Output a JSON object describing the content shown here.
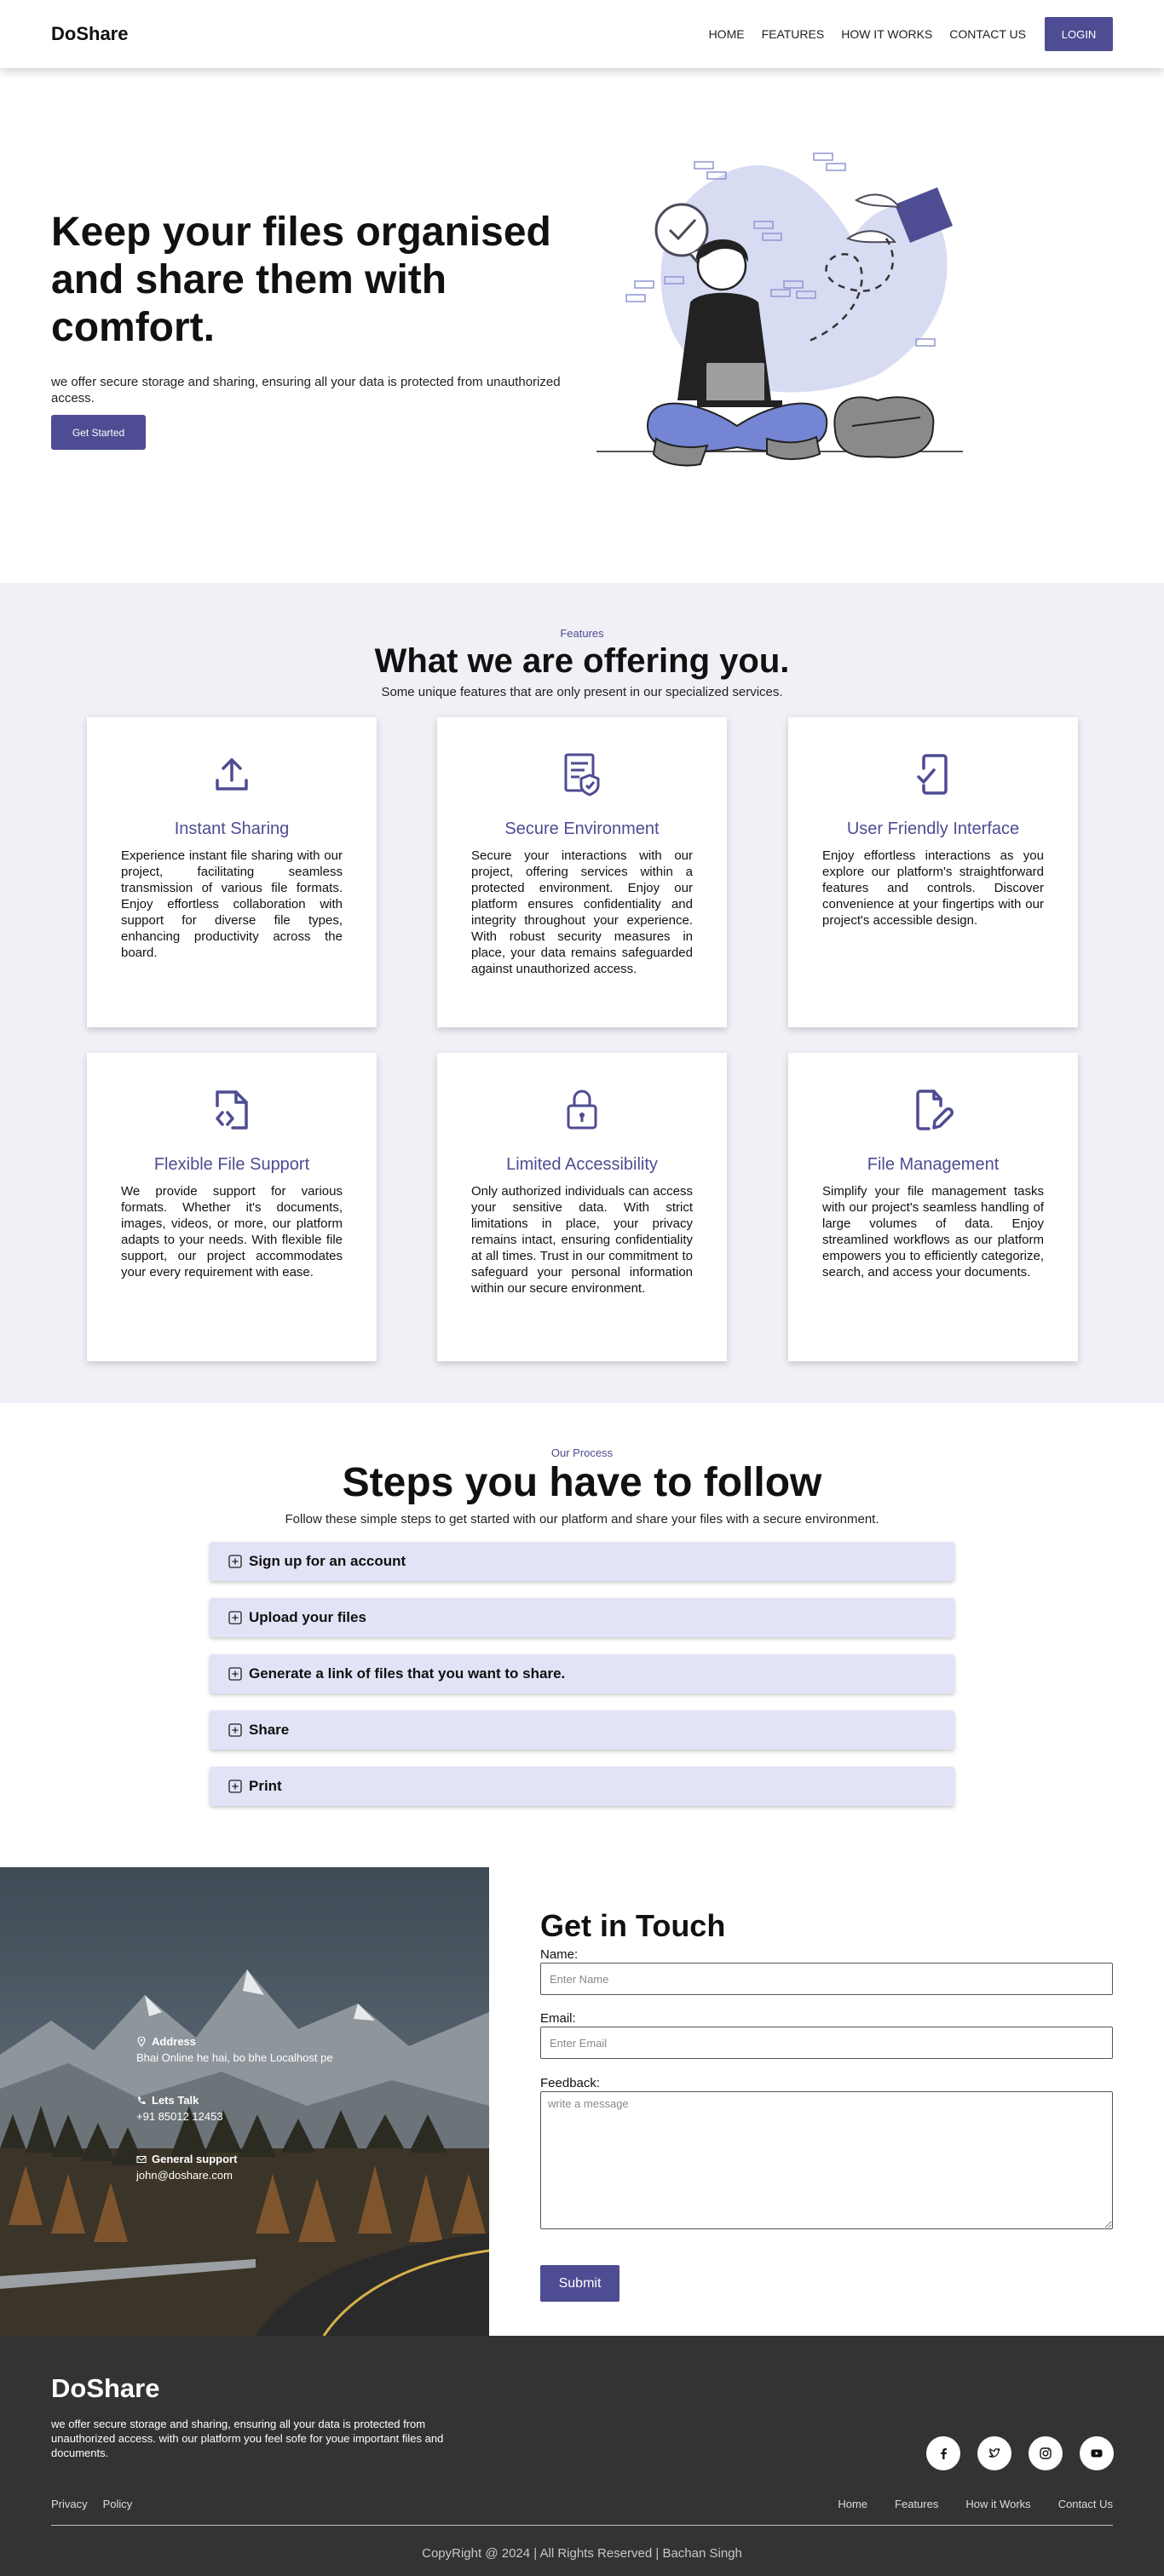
{
  "nav": {
    "brand": "DoShare",
    "links": [
      "HOME",
      "FEATURES",
      "HOW IT WORKS",
      "CONTACT US"
    ],
    "login": "LOGIN"
  },
  "hero": {
    "title": "Keep your files organised and share them with comfort.",
    "subtitle": "we offer secure storage and sharing, ensuring all your data is protected from unauthorized access.",
    "cta": "Get Started"
  },
  "features": {
    "eyebrow": "Features",
    "title": "What we are offering you.",
    "subtitle": "Some unique features that are only present in our specialized services.",
    "cards": [
      {
        "icon": "upload-icon",
        "title": "Instant Sharing",
        "text": "Experience instant file sharing with our project, facilitating seamless transmission of various file formats. Enjoy effortless collaboration with support for diverse file types, enhancing productivity across the board."
      },
      {
        "icon": "shield-document-icon",
        "title": "Secure Environment",
        "text": "Secure your interactions with our project, offering services within a protected environment. Enjoy our platform ensures confidentiality and integrity throughout your experience. With robust security measures in place, your data remains safeguarded against unauthorized access."
      },
      {
        "icon": "mobile-check-icon",
        "title": "User Friendly Interface",
        "text": "Enjoy effortless interactions as you explore our platform's straightforward features and controls. Discover convenience at your fingertips with our project's accessible design."
      },
      {
        "icon": "file-code-icon",
        "title": "Flexible File Support",
        "text": "We provide support for various formats. Whether it's documents, images, videos, or more, our platform adapts to your needs. With flexible file support, our project accommodates your every requirement with ease."
      },
      {
        "icon": "lock-icon",
        "title": "Limited Accessibility",
        "text": "Only authorized individuals can access your sensitive data. With strict limitations in place, your privacy remains intact, ensuring confidentiality at all times. Trust in our commitment to safeguard your personal information within our secure environment."
      },
      {
        "icon": "file-edit-icon",
        "title": "File Management",
        "text": "Simplify your file management tasks with our project's seamless handling of large volumes of data. Enjoy streamlined workflows as our platform empowers you to efficiently categorize, search, and access your documents."
      }
    ]
  },
  "steps": {
    "eyebrow": "Our Process",
    "title": "Steps you have to follow",
    "subtitle": "Follow these simple steps to get started with our platform and share your files with a secure environment.",
    "items": [
      "Sign up for an account",
      "Upload your files",
      "Generate a link of files that you want to share.",
      "Share",
      "Print"
    ]
  },
  "contact": {
    "address_label": "Address",
    "address_value": "Bhai Online he hai, bo bhe Localhost pe",
    "talk_label": "Lets Talk",
    "talk_value": "+91 85012 12453",
    "support_label": "General support",
    "support_value": "john@doshare.com",
    "title": "Get in Touch",
    "name_label": "Name:",
    "name_placeholder": "Enter Name",
    "email_label": "Email:",
    "email_placeholder": "Enter Email",
    "feedback_label": "Feedback:",
    "feedback_placeholder": "write a message",
    "submit": "Submit"
  },
  "footer": {
    "brand": "DoShare",
    "description": "we offer secure storage and sharing, ensuring all your data is protected from unauthorized access. with our platform you feel sofe for youe important files and documents.",
    "socials": [
      "facebook-icon",
      "twitter-icon",
      "instagram-icon",
      "youtube-icon"
    ],
    "left_links": [
      "Privacy",
      "Policy"
    ],
    "right_links": [
      "Home",
      "Features",
      "How it Works",
      "Contact Us"
    ],
    "copyright": "CopyRight @ 2024 | All Rights Reserved | Bachan Singh"
  },
  "colors": {
    "accent": "#4e4c92",
    "features_bg": "#f0f0f6",
    "accordion_bg": "#e2e3f6",
    "footer_bg": "#333333"
  }
}
